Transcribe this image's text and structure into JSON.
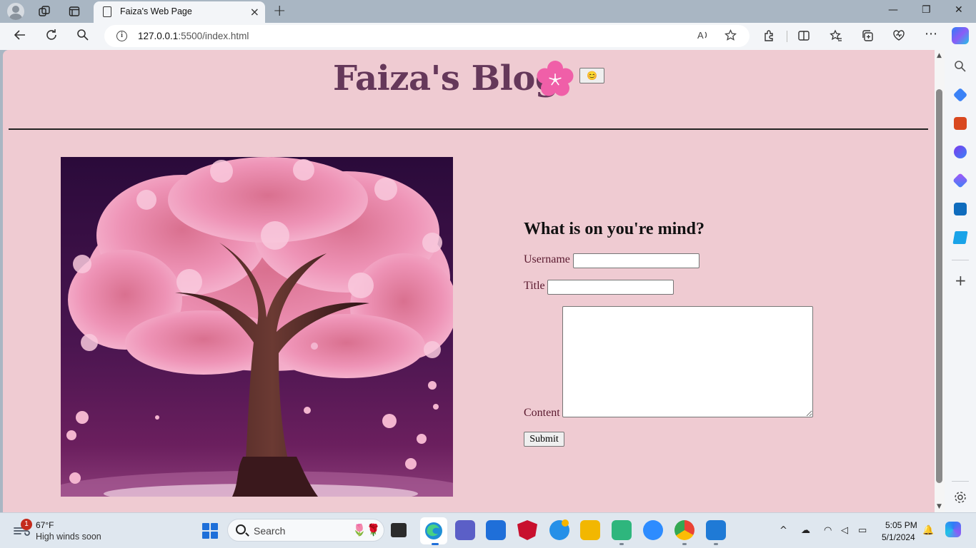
{
  "browser": {
    "tab_title": "Faiza's Web Page",
    "url_host": "127.0.0.1",
    "url_path": ":5500/index.html",
    "new_tab": "+",
    "close_tab": "×",
    "minimize": "—",
    "restore": "❐",
    "close": "✕"
  },
  "page": {
    "blog_title": "Faiza's Blog",
    "emoji_button_label": "😊",
    "form_heading": "What is on you're mind?",
    "username_label": "Username",
    "title_label": "Title",
    "content_label": "Content",
    "submit_label": "Submit",
    "image_alt": "cherry blossom tree",
    "colors": {
      "background": "#efcbd2",
      "title": "#65385a",
      "flower": "#f05fa8",
      "label": "#5a1a2f"
    }
  },
  "taskbar": {
    "weather_badge": "1",
    "temperature": "67°F",
    "weather_text": "High winds soon",
    "search_placeholder": "Search",
    "time": "5:05 PM",
    "date": "5/1/2024"
  },
  "icons": {
    "back": "arrow-left-icon",
    "refresh": "refresh-icon",
    "search": "search-icon",
    "favorite": "star-icon",
    "extensions": "puzzle-icon",
    "settings": "gear-icon"
  }
}
